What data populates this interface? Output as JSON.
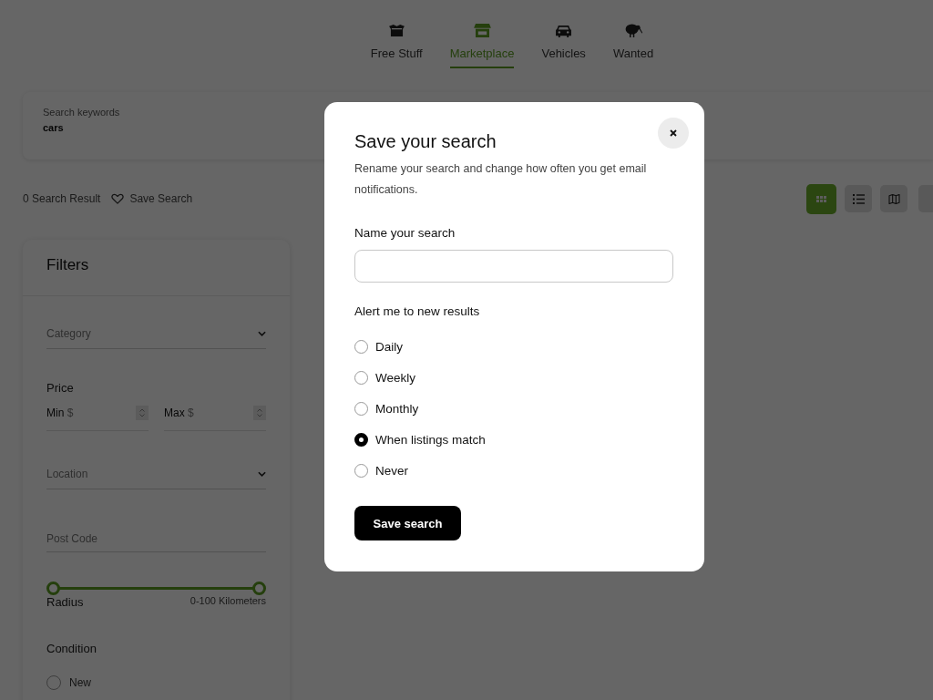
{
  "nav_tabs": [
    {
      "kind": "box",
      "label": "Free Stuff",
      "selected": false
    },
    {
      "kind": "store",
      "label": "Marketplace",
      "selected": true
    },
    {
      "kind": "car",
      "label": "Vehicles",
      "selected": false
    },
    {
      "kind": "bird",
      "label": "Wanted",
      "selected": false
    }
  ],
  "search": {
    "label": "Search keywords",
    "value": "cars"
  },
  "results_bar": {
    "count": "0 Search Result",
    "save_link": "Save Search",
    "views": [
      {
        "kind": "grid",
        "selected": true
      },
      {
        "kind": "list",
        "selected": false
      },
      {
        "kind": "map",
        "selected": false
      },
      {
        "kind": "unknown",
        "selected": false
      }
    ]
  },
  "filters": {
    "title": "Filters",
    "category": {
      "placeholder": "Category"
    },
    "price": {
      "label": "Price",
      "inputs": [
        {
          "label": "Min",
          "prefix": "$"
        },
        {
          "label": "Max",
          "prefix": "$"
        }
      ]
    },
    "location": {
      "placeholder": "Location"
    },
    "post_code": {
      "placeholder": "Post Code"
    },
    "radius": {
      "label": "Radius",
      "reading": "0-100 Kilometers",
      "thumbs": [
        {
          "level": 0
        },
        {
          "level": 1
        }
      ]
    },
    "condition": {
      "label": "Condition",
      "options": [
        {
          "label": "New",
          "selected": false
        }
      ]
    }
  },
  "modal": {
    "title": "Save your search",
    "description": "Rename your search and change how often you get email notifications.",
    "name_label": "Name your search",
    "alert_label": "Alert me to new results",
    "alert_options": [
      {
        "label": "Daily",
        "selected": false
      },
      {
        "label": "Weekly",
        "selected": false
      },
      {
        "label": "Monthly",
        "selected": false
      },
      {
        "label": "When listings match",
        "selected": true
      },
      {
        "label": "Never",
        "selected": false
      }
    ],
    "submit": "Save search"
  }
}
